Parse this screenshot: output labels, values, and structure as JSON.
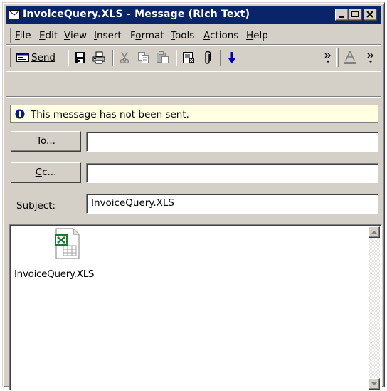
{
  "window": {
    "title": "InvoiceQuery.XLS - Message (Rich Text)",
    "title_bar_color": "#0a246a",
    "title_icon": "envelope-icon",
    "controls": [
      "minimize-icon",
      "maximize-icon",
      "close-icon"
    ]
  },
  "menu": {
    "items": [
      {
        "label": "File",
        "access_key": "F"
      },
      {
        "label": "Edit",
        "access_key": "E"
      },
      {
        "label": "View",
        "access_key": "V"
      },
      {
        "label": "Insert",
        "access_key": "I"
      },
      {
        "label": "Format",
        "access_key": "o"
      },
      {
        "label": "Tools",
        "access_key": "T"
      },
      {
        "label": "Actions",
        "access_key": "A"
      },
      {
        "label": "Help",
        "access_key": "H"
      }
    ]
  },
  "toolbar": {
    "send_label": "Send",
    "icons": [
      "send-icon",
      "save-icon",
      "print-icon",
      "cut-icon",
      "copy-icon",
      "paste-icon",
      "address-book-icon",
      "attach-icon",
      "arrow-down-icon",
      "more-chevron-icon",
      "font-color-icon",
      "more-chevron-icon"
    ]
  },
  "infobar": {
    "text": "This message has not been sent.",
    "icon": "info-icon",
    "background": "#ffffe1"
  },
  "to": {
    "button_label": "To...",
    "value": ""
  },
  "cc": {
    "button_label": "Cc...",
    "value": ""
  },
  "subject": {
    "label": "Subject:",
    "value": "InvoiceQuery.XLS"
  },
  "body": {
    "attachment": {
      "name": "InvoiceQuery.XLS",
      "icon": "excel-file-icon"
    }
  }
}
